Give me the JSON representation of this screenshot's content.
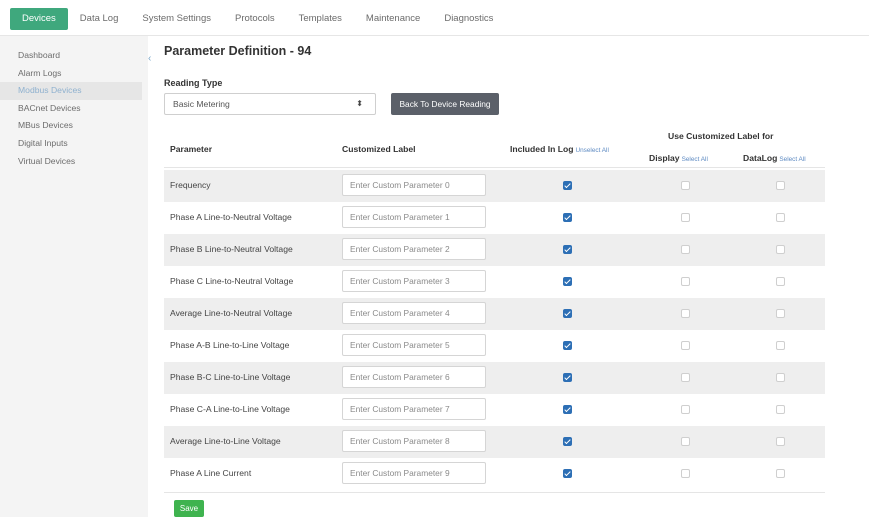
{
  "topnav": {
    "tabs": [
      "Devices",
      "Data Log",
      "System Settings",
      "Protocols",
      "Templates",
      "Maintenance",
      "Diagnostics"
    ],
    "active_tab": "Devices"
  },
  "sidebar": {
    "items": [
      "Dashboard",
      "Alarm Logs",
      "Modbus Devices",
      "BACnet Devices",
      "MBus Devices",
      "Digital Inputs",
      "Virtual Devices"
    ],
    "active_item": "Modbus Devices"
  },
  "collapse_glyph": "‹",
  "page": {
    "title": "Parameter Definition - 94",
    "reading_type_label": "Reading Type",
    "reading_type_value": "Basic Metering",
    "caret_glyph": "⬍",
    "back_button": "Back To Device Reading"
  },
  "table": {
    "headers": {
      "parameter": "Parameter",
      "customized_label": "Customized Label",
      "included_in_log": "Included In Log",
      "unselect_all": "Unselect All",
      "use_customized_label_for": "Use Customized Label for",
      "display": "Display",
      "datalog": "DataLog",
      "select_all": "Select All"
    },
    "rows": [
      {
        "parameter": "Frequency",
        "placeholder": "Enter Custom Parameter 0",
        "included_in_log": true,
        "display": false,
        "datalog": false
      },
      {
        "parameter": "Phase A Line-to-Neutral Voltage",
        "placeholder": "Enter Custom Parameter 1",
        "included_in_log": true,
        "display": false,
        "datalog": false
      },
      {
        "parameter": "Phase B Line-to-Neutral Voltage",
        "placeholder": "Enter Custom Parameter 2",
        "included_in_log": true,
        "display": false,
        "datalog": false
      },
      {
        "parameter": "Phase C Line-to-Neutral Voltage",
        "placeholder": "Enter Custom Parameter 3",
        "included_in_log": true,
        "display": false,
        "datalog": false
      },
      {
        "parameter": "Average Line-to-Neutral Voltage",
        "placeholder": "Enter Custom Parameter 4",
        "included_in_log": true,
        "display": false,
        "datalog": false
      },
      {
        "parameter": "Phase A-B Line-to-Line Voltage",
        "placeholder": "Enter Custom Parameter 5",
        "included_in_log": true,
        "display": false,
        "datalog": false
      },
      {
        "parameter": "Phase B-C Line-to-Line Voltage",
        "placeholder": "Enter Custom Parameter 6",
        "included_in_log": true,
        "display": false,
        "datalog": false
      },
      {
        "parameter": "Phase C-A Line-to-Line Voltage",
        "placeholder": "Enter Custom Parameter 7",
        "included_in_log": true,
        "display": false,
        "datalog": false
      },
      {
        "parameter": "Average Line-to-Line Voltage",
        "placeholder": "Enter Custom Parameter 8",
        "included_in_log": true,
        "display": false,
        "datalog": false
      },
      {
        "parameter": "Phase A Line Current",
        "placeholder": "Enter Custom Parameter 9",
        "included_in_log": true,
        "display": false,
        "datalog": false
      }
    ]
  },
  "save_button": "Save",
  "colors": {
    "accent_green": "#3fa87d",
    "save_green": "#3fb34f",
    "checkbox_blue": "#2d6fb5",
    "link_blue": "#5d8ac2",
    "back_button_gray": "#5b6069"
  }
}
